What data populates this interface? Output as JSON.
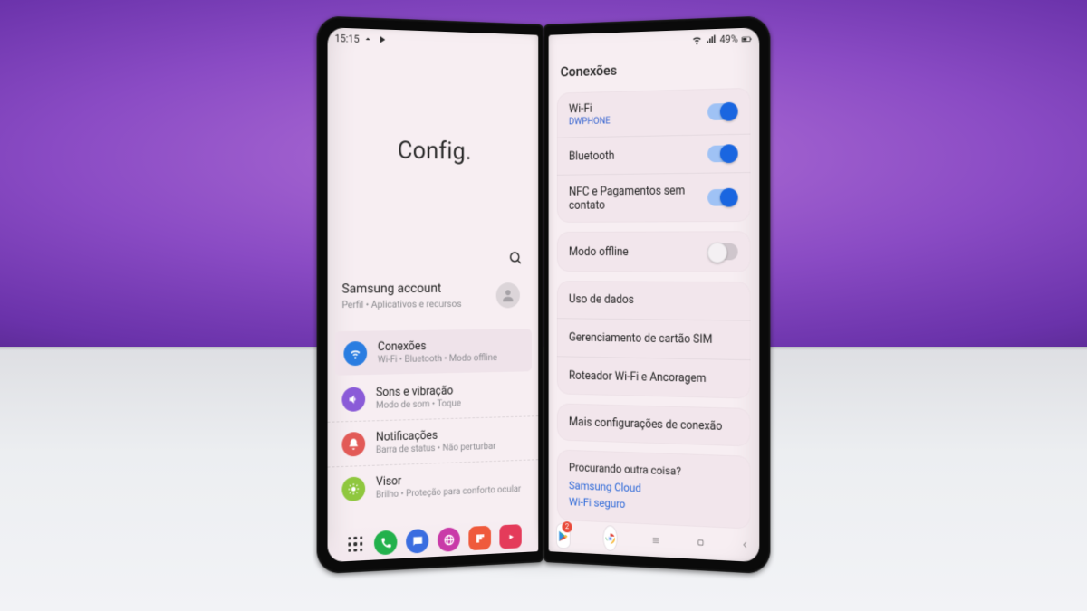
{
  "statusbar": {
    "time": "15:15",
    "battery": "49%"
  },
  "left": {
    "title": "Config.",
    "account": {
      "title": "Samsung account",
      "subtitle": "Perfil  •  Aplicativos e recursos"
    },
    "categories": [
      {
        "title": "Conexões",
        "subtitle": "Wi-Fi  •  Bluetooth  •  Modo offline",
        "icon": "wifi",
        "color": "blue",
        "active": true
      },
      {
        "title": "Sons e vibração",
        "subtitle": "Modo de som  •  Toque",
        "icon": "sound",
        "color": "purple",
        "active": false
      },
      {
        "title": "Notificações",
        "subtitle": "Barra de status  •  Não perturbar",
        "icon": "bell",
        "color": "red",
        "active": false
      },
      {
        "title": "Visor",
        "subtitle": "Brilho  •  Proteção para conforto ocular",
        "icon": "sun",
        "color": "green",
        "active": false
      }
    ]
  },
  "right": {
    "heading": "Conexões",
    "toggles": [
      {
        "title": "Wi-Fi",
        "subtitle": "DWPHONE",
        "on": true
      },
      {
        "title": "Bluetooth",
        "subtitle": "",
        "on": true
      },
      {
        "title": "NFC e Pagamentos sem contato",
        "subtitle": "",
        "on": true
      }
    ],
    "offline": {
      "title": "Modo offline",
      "on": false
    },
    "links": [
      "Uso de dados",
      "Gerenciamento de cartão SIM",
      "Roteador Wi-Fi e Ancoragem"
    ],
    "more": "Mais configurações de conexão",
    "looking": {
      "prompt": "Procurando outra coisa?",
      "links": [
        "Samsung Cloud",
        "Wi-Fi seguro"
      ]
    }
  },
  "dock_badge": "2"
}
